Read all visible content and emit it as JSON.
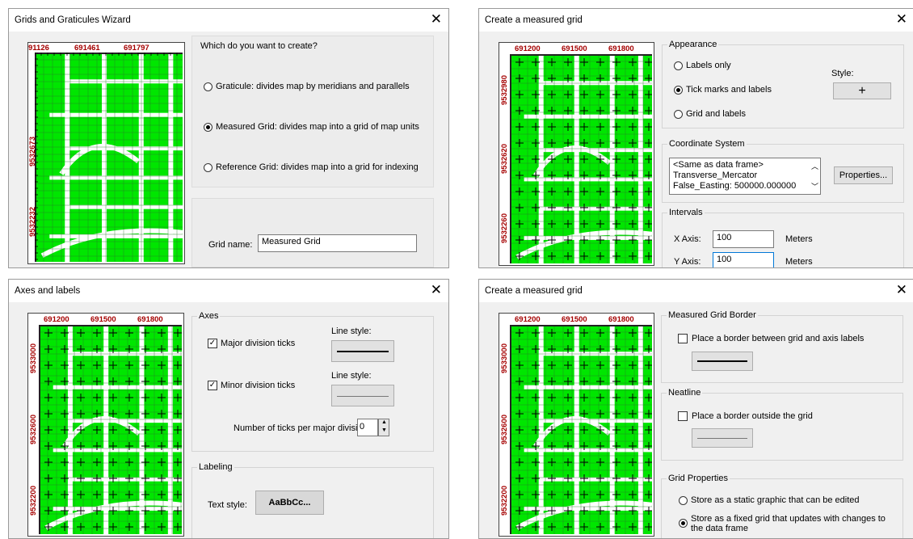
{
  "dialogs": {
    "wizard": {
      "title": "Grids and Graticules Wizard",
      "map_labels": {
        "top": [
          "91126",
          "691461",
          "691797"
        ],
        "left": [
          "9532673",
          "9532232"
        ]
      },
      "question": "Which do you want to create?",
      "options": [
        {
          "label": "Graticule: divides map by meridians and parallels",
          "selected": false
        },
        {
          "label": "Measured Grid: divides map into a grid of map units",
          "selected": true
        },
        {
          "label": "Reference Grid: divides map into a grid for indexing",
          "selected": false
        }
      ],
      "grid_name_label": "Grid name:",
      "grid_name_value": "Measured Grid"
    },
    "measured1": {
      "title": "Create a measured grid",
      "map_labels": {
        "top": [
          "691200",
          "691500",
          "691800"
        ],
        "left": [
          "9532980",
          "9532620",
          "9532260"
        ]
      },
      "appearance": {
        "label": "Appearance",
        "options": [
          {
            "label": "Labels only",
            "selected": false
          },
          {
            "label": "Tick marks and labels",
            "selected": true
          },
          {
            "label": "Grid and labels",
            "selected": false
          }
        ],
        "style_label": "Style:",
        "style_value": "+"
      },
      "coordinate_system": {
        "label": "Coordinate System",
        "lines": [
          "<Same as data frame>",
          "Transverse_Mercator",
          "False_Easting: 500000.000000"
        ],
        "properties_button": "Properties..."
      },
      "intervals": {
        "label": "Intervals",
        "x_label": "X Axis:",
        "x_value": "100",
        "x_unit": "Meters",
        "y_label": "Y Axis:",
        "y_value": "100",
        "y_unit": "Meters"
      }
    },
    "axes": {
      "title": "Axes and labels",
      "map_labels": {
        "top": [
          "691200",
          "691500",
          "691800"
        ],
        "left": [
          "9533000",
          "9532600",
          "9532200"
        ]
      },
      "axes_group": {
        "label": "Axes",
        "major_label": "Major division ticks",
        "major_checked": true,
        "minor_label": "Minor division ticks",
        "minor_checked": true,
        "line_style_label": "Line style:",
        "ticks_label": "Number of ticks per major division:",
        "ticks_value": "0"
      },
      "labeling": {
        "label": "Labeling",
        "text_style_label": "Text style:",
        "text_style_button": "AaBbCc..."
      }
    },
    "measured2": {
      "title": "Create a measured grid",
      "map_labels": {
        "top": [
          "691200",
          "691500",
          "691800"
        ],
        "left": [
          "9533000",
          "9532600",
          "9532200"
        ]
      },
      "border_group": {
        "label": "Measured Grid Border",
        "checkbox": "Place a border between grid and axis labels",
        "checked": false
      },
      "neatline_group": {
        "label": "Neatline",
        "checkbox": "Place a border outside the grid",
        "checked": false
      },
      "properties_group": {
        "label": "Grid Properties",
        "options": [
          {
            "label": "Store as a static graphic that can be edited",
            "selected": false
          },
          {
            "label": "Store as a fixed grid that updates with changes to",
            "label2": "the data frame",
            "selected": true
          }
        ]
      }
    }
  },
  "colors": {
    "map_fill": "#00e600",
    "label_red": "#a50000",
    "road": "#ffffff"
  },
  "icons": [
    "close-icon",
    "spin-up-icon",
    "spin-down-icon",
    "scroll-up-icon",
    "scroll-down-icon"
  ]
}
